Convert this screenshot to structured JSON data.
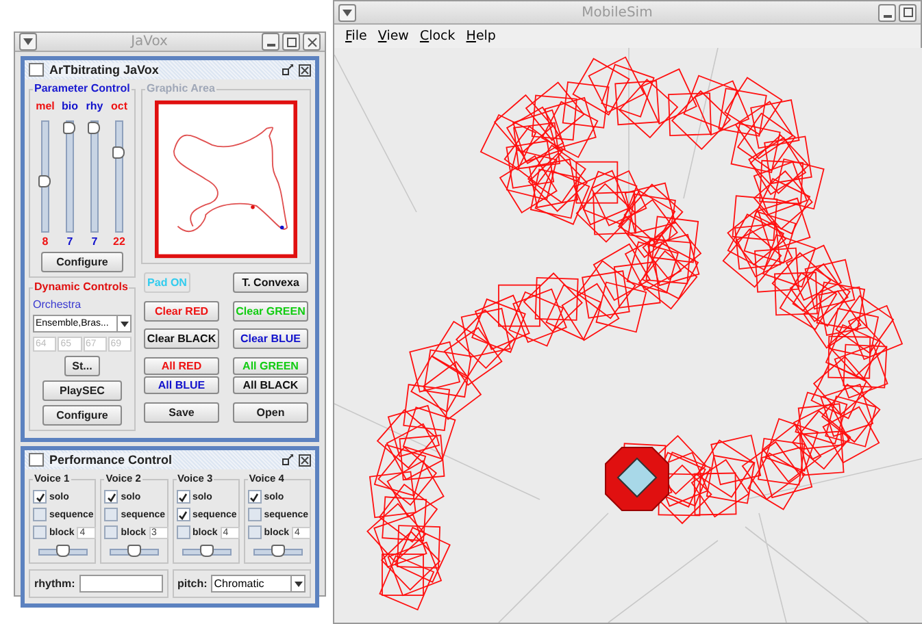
{
  "javox_window": {
    "title": "JaVox"
  },
  "arbitrating_frame": {
    "title": "ArTbitrating JaVox"
  },
  "parameter_control": {
    "title": "Parameter Control",
    "sliders": [
      {
        "label": "mel",
        "level": 0.45,
        "value": "8",
        "color": "#ee1111"
      },
      {
        "label": "bio",
        "level": 1.0,
        "value": "7",
        "color": "#1111cc"
      },
      {
        "label": "rhy",
        "level": 1.0,
        "value": "7",
        "color": "#1111cc"
      },
      {
        "label": "oct",
        "level": 0.75,
        "value": "22",
        "color": "#ee1111"
      }
    ],
    "configure_button": "Configure"
  },
  "dynamic_controls": {
    "title": "Dynamic Controls",
    "orchestra_label": "Orchestra",
    "orchestra_select": "Ensemble,Bras...",
    "note_fields": [
      "64",
      "65",
      "67",
      "69"
    ],
    "buttons": [
      "St...",
      "PlaySEC",
      "Configure"
    ]
  },
  "graphic_area": {
    "title": "Graphic Area"
  },
  "pad_buttons": [
    {
      "label": "Pad ON",
      "color": "#33ccee"
    },
    {
      "label": "T. Convexa",
      "color": "#111111"
    }
  ],
  "color_buttons": [
    {
      "label": "Clear RED",
      "color": "#ee1111"
    },
    {
      "label": "Clear GREEN",
      "color": "#11cc11"
    },
    {
      "label": "Clear BLACK",
      "color": "#111111"
    },
    {
      "label": "Clear BLUE",
      "color": "#1111cc"
    }
  ],
  "all_buttons": [
    {
      "label": "All RED",
      "color": "#ee1111"
    },
    {
      "label": "All GREEN",
      "color": "#11cc11"
    },
    {
      "label": "All BLUE",
      "color": "#1111cc"
    },
    {
      "label": "All BLACK",
      "color": "#111111"
    }
  ],
  "file_buttons": [
    "Save",
    "Open"
  ],
  "performance_frame": {
    "title": "Performance Control",
    "voices": [
      {
        "title": "Voice 1",
        "solo_label": "solo",
        "solo": true,
        "sequence_label": "sequence",
        "sequence": false,
        "block_label": "block",
        "block": false,
        "block_value": "4",
        "level": 0.5
      },
      {
        "title": "Voice 2",
        "solo_label": "solo",
        "solo": true,
        "sequence_label": "sequence",
        "sequence": false,
        "block_label": "block",
        "block": false,
        "block_value": "3",
        "level": 0.5
      },
      {
        "title": "Voice 3",
        "solo_label": "solo",
        "solo": true,
        "sequence_label": "sequence",
        "sequence": true,
        "block_label": "block",
        "block": false,
        "block_value": "4",
        "level": 0.5
      },
      {
        "title": "Voice 4",
        "solo_label": "solo",
        "solo": true,
        "sequence_label": "sequence",
        "sequence": false,
        "block_label": "block",
        "block": false,
        "block_value": "4",
        "level": 0.5
      }
    ],
    "rhythm_label": "rhythm:",
    "pitch_label": "pitch:",
    "pitch_select": "Chromatic"
  },
  "mobilesim_window": {
    "title": "MobileSim",
    "menu": [
      "File",
      "View",
      "Clock",
      "Help"
    ]
  }
}
